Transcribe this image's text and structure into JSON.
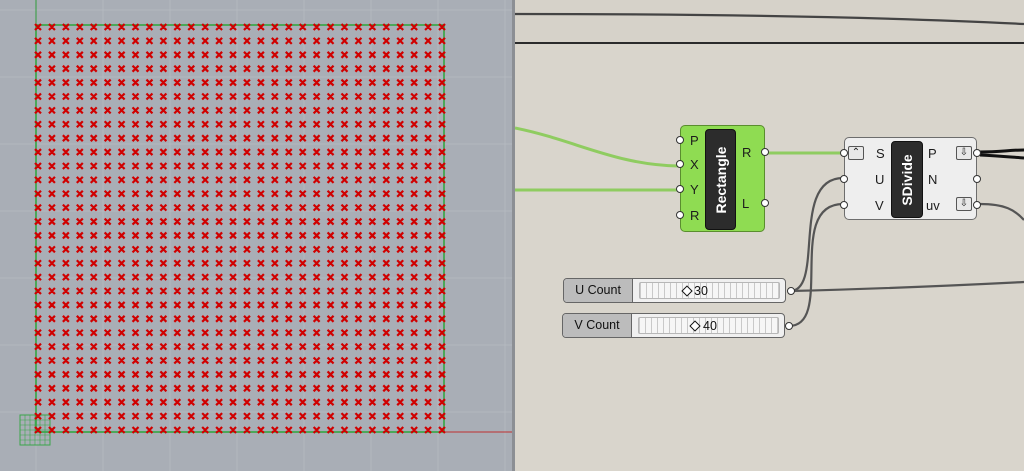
{
  "rectangle": {
    "name": "Rectangle",
    "inputs": [
      "P",
      "X",
      "Y",
      "R"
    ],
    "outputs": [
      "R",
      "L"
    ]
  },
  "sdivide": {
    "name": "SDivide",
    "inputs": [
      "S",
      "U",
      "V"
    ],
    "outputs": [
      "P",
      "N",
      "uv"
    ]
  },
  "sliders": [
    {
      "label": "U Count",
      "value": "30",
      "level": 0.35
    },
    {
      "label": "V Count",
      "value": "40",
      "level": 0.36
    }
  ],
  "grid": {
    "columns": 30,
    "rows": 30,
    "marker_color": "#d00000"
  },
  "colors": {
    "viewport_bg": "#a9aeb6",
    "canvas_bg": "#d9d5cc",
    "selected_component": "#8fdc52",
    "wire_green": "#8fcc60",
    "wire_dark": "#555555"
  }
}
